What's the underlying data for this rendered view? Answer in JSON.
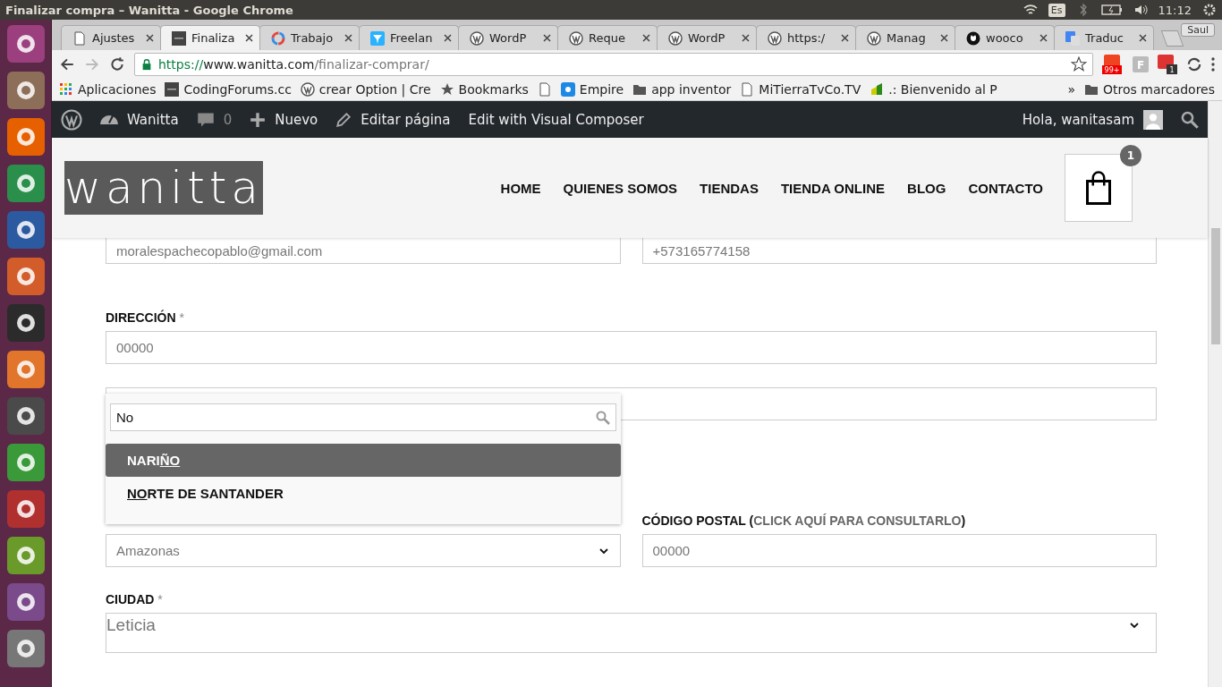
{
  "top_panel": {
    "title": "Finalizar compra – Wanitta - Google Chrome",
    "keyboard": "Es",
    "clock": "11:12"
  },
  "tabs": [
    {
      "title": "Ajustes",
      "kind": "page",
      "selected": false
    },
    {
      "title": "Finaliza",
      "kind": "site",
      "selected": true
    },
    {
      "title": "Trabajo",
      "kind": "ring",
      "selected": false
    },
    {
      "title": "Freelan",
      "kind": "bird",
      "selected": false
    },
    {
      "title": "WordP",
      "kind": "wordpress",
      "selected": false
    },
    {
      "title": "Reque",
      "kind": "wordpress",
      "selected": false
    },
    {
      "title": "WordP",
      "kind": "wordpress",
      "selected": false
    },
    {
      "title": "https:/",
      "kind": "wordpress",
      "selected": false
    },
    {
      "title": "Manag",
      "kind": "wordpress",
      "selected": false
    },
    {
      "title": "wooco",
      "kind": "github",
      "selected": false
    },
    {
      "title": "Traduc",
      "kind": "translate",
      "selected": false
    }
  ],
  "profile": "Saul",
  "address_bar": {
    "scheme": "https://",
    "host": "www.wanitta.com",
    "path": "/finalizar-comprar/"
  },
  "extensions": [
    {
      "kind": "counter",
      "badge": "99+"
    },
    {
      "kind": "letter",
      "badge": "F"
    },
    {
      "kind": "dots",
      "badge": "1"
    },
    {
      "kind": "sync"
    }
  ],
  "bookmarks": [
    {
      "title": "Aplicaciones",
      "kind": "apps"
    },
    {
      "title": "CodingForums.cc",
      "kind": "site"
    },
    {
      "title": "crear Option | Cre",
      "kind": "wordpress"
    },
    {
      "title": "Bookmarks",
      "kind": "star"
    },
    {
      "kind": "page"
    },
    {
      "title": "Empire",
      "kind": "badge"
    },
    {
      "title": "app inventor",
      "kind": "folder"
    },
    {
      "title": "MiTierraTvCo.TV",
      "kind": "page"
    },
    {
      "title": ".: Bienvenido al P",
      "kind": "leaf"
    }
  ],
  "bookmarks_more": "»",
  "other_bookmarks": "Otros marcadores",
  "admin_bar": {
    "site": "Wanitta",
    "comments": "0",
    "new": "Nuevo",
    "edit": "Editar página",
    "composer": "Edit with Visual Composer",
    "greeting": "Hola, wanitasam"
  },
  "header": {
    "logo": "wanitta",
    "nav": [
      "HOME",
      "QUIENES SOMOS",
      "TIENDAS",
      "TIENDA ONLINE",
      "BLOG",
      "CONTACTO"
    ],
    "cart_count": "1"
  },
  "form": {
    "email": {
      "value": "moralespachecopablo@gmail.com"
    },
    "phone": {
      "value": "+573165774158"
    },
    "address": {
      "label": "DIRECCIÓN",
      "required": "*",
      "placeholder": "00000"
    },
    "department": {
      "value": "Amazonas"
    },
    "postal": {
      "label": "CÓDIGO POSTAL (",
      "link": "CLICK AQUÍ PARA CONSULTARLO",
      "label_end": ")",
      "placeholder": "00000"
    },
    "city": {
      "label": "CIUDAD",
      "required": "*",
      "value": "Leticia"
    }
  },
  "dropdown": {
    "search": "No",
    "options": [
      {
        "before": "NARI",
        "match": "ÑO",
        "selected": true
      },
      {
        "match": "NO",
        "after": "RTE DE SANTANDER",
        "selected": false
      }
    ]
  }
}
